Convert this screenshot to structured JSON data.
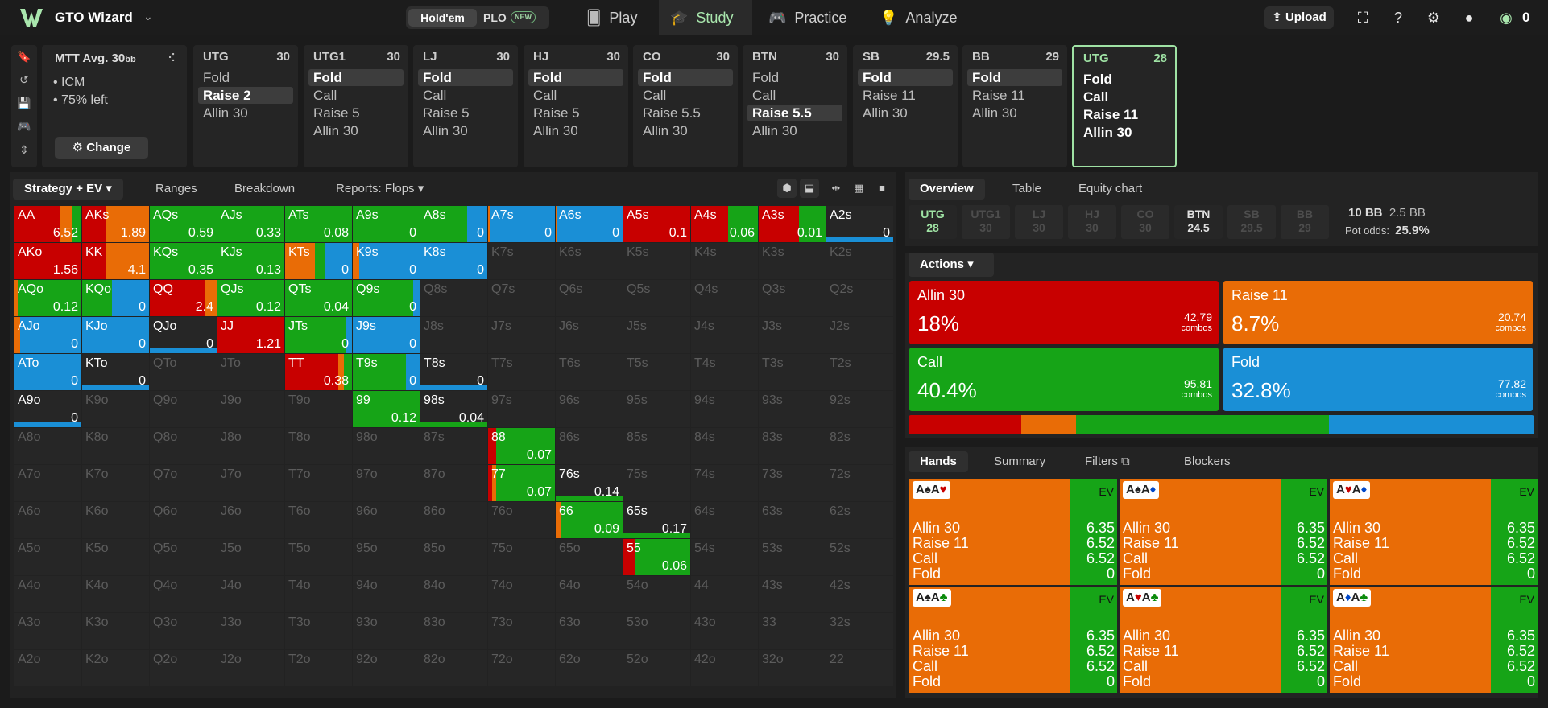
{
  "app": {
    "name": "GTO Wizard"
  },
  "topbar": {
    "variant": {
      "holdem": "Hold'em",
      "plo": "PLO",
      "new_badge": "NEW"
    },
    "nav": [
      "Play",
      "Study",
      "Practice",
      "Analyze"
    ],
    "active_nav": "Study",
    "upload": "Upload",
    "coins": "0"
  },
  "spot": {
    "title": "MTT  Avg. 30",
    "title_suffix": "bb",
    "bullets": [
      "• ICM",
      "• 75% left"
    ],
    "change_label": "Change"
  },
  "action_cards": [
    {
      "pos": "UTG",
      "stack": "30",
      "actions": [
        "Fold",
        "Raise 2",
        "Allin 30"
      ],
      "selected": 1
    },
    {
      "pos": "UTG1",
      "stack": "30",
      "actions": [
        "Fold",
        "Call",
        "Raise 5",
        "Allin 30"
      ],
      "selected": 0
    },
    {
      "pos": "LJ",
      "stack": "30",
      "actions": [
        "Fold",
        "Call",
        "Raise 5",
        "Allin 30"
      ],
      "selected": 0
    },
    {
      "pos": "HJ",
      "stack": "30",
      "actions": [
        "Fold",
        "Call",
        "Raise 5",
        "Allin 30"
      ],
      "selected": 0
    },
    {
      "pos": "CO",
      "stack": "30",
      "actions": [
        "Fold",
        "Call",
        "Raise 5.5",
        "Allin 30"
      ],
      "selected": 0
    },
    {
      "pos": "BTN",
      "stack": "30",
      "actions": [
        "Fold",
        "Call",
        "Raise 5.5",
        "Allin 30"
      ],
      "selected": 2
    },
    {
      "pos": "SB",
      "stack": "29.5",
      "actions": [
        "Fold",
        "Raise 11",
        "Allin 30"
      ],
      "selected": 0
    },
    {
      "pos": "BB",
      "stack": "29",
      "actions": [
        "Fold",
        "Raise 11",
        "Allin 30"
      ],
      "selected": 0
    },
    {
      "pos": "UTG",
      "stack": "28",
      "actions": [
        "Fold",
        "Call",
        "Raise 11",
        "Allin 30"
      ],
      "selected": -1,
      "current": true
    }
  ],
  "matrix_tabs": {
    "strategy": "Strategy + EV",
    "ranges": "Ranges",
    "breakdown": "Breakdown",
    "reports": "Reports: Flops"
  },
  "colors": {
    "allin": "#c80000",
    "raise": "#e96c06",
    "call": "#16a417",
    "fold": "#1a8fd6",
    "empty": "#262626"
  },
  "matrix": [
    [
      "AA|r:.68,o:.17,g:.15|6.52",
      "AKs|r:.35,o:.65|1.89",
      "AQs|g:1|0.59",
      "AJs|g:1|0.33",
      "ATs|g:1|0.08",
      "A9s|g:1|0",
      "A8s|g:.7,b:.3|0",
      "A7s|o:.03,b:.97|0",
      "A6s|o:.03,b:.97|0",
      "A5s|r:1|0.1",
      "A4s|r:.55,g:.45|0.06",
      "A3s|r:.6,g:.4|0.01",
      "A2s|b:p|0"
    ],
    [
      "AKo|r:1|1.56",
      "KK|r:.35,o:.65|4.1",
      "KQs|g:1|0.35",
      "KJs|g:1|0.13",
      "KTs|o:.45,g:.15,b:.4|0",
      "K9s|o:.1,b:.9|0",
      "K8s|b:1|0",
      "K7s",
      "K6s",
      "K5s",
      "K4s",
      "K3s",
      "K2s"
    ],
    [
      "AQo|o:.05,g:.95|0.12",
      "KQo|g:.45,b:.55|0",
      "QQ|r:.82,o:.18|2.4",
      "QJs|g:1|0.12",
      "QTs|g:1|0.04",
      "Q9s|g:.9,b:.1|0",
      "Q8s",
      "Q7s",
      "Q6s",
      "Q5s",
      "Q4s",
      "Q3s",
      "Q2s"
    ],
    [
      "AJo|o:.08,b:.92|0",
      "KJo|b:1|0",
      "QJo|b:p|0",
      "JJ|r:1|1.21",
      "JTs|g:.9,b:.1|0",
      "J9s|b:1|0",
      "J8s",
      "J7s",
      "J6s",
      "J5s",
      "J4s",
      "J3s",
      "J2s"
    ],
    [
      "ATo|b:1|0",
      "KTo|b:p|0",
      "QTo",
      "JTo",
      "TT|r:.8,o:.08,g:.12|0.38",
      "T9s|g:.8,b:.2|0",
      "T8s|b:p|0",
      "T7s",
      "T6s",
      "T5s",
      "T4s",
      "T3s",
      "T2s"
    ],
    [
      "A9o|b:p|0",
      "K9o",
      "Q9o",
      "J9o",
      "T9o",
      "99|g:1|0.12",
      "98s|g:p|0.04",
      "97s",
      "96s",
      "95s",
      "94s",
      "93s",
      "92s"
    ],
    [
      "A8o",
      "K8o",
      "Q8o",
      "J8o",
      "T8o",
      "98o",
      "87s",
      "88|r:.12,g:.88|0.07",
      "86s",
      "85s",
      "84s",
      "83s",
      "82s"
    ],
    [
      "A7o",
      "K7o",
      "Q7o",
      "J7o",
      "T7o",
      "97o",
      "87o",
      "77|r:.06,o:.06,g:.88|0.07",
      "76s|g:p|0.14",
      "75s",
      "74s",
      "73s",
      "72s"
    ],
    [
      "A6o",
      "K6o",
      "Q6o",
      "J6o",
      "T6o",
      "96o",
      "86o",
      "76o",
      "66|o:.08,g:.92|0.09",
      "65s|g:p|0.17",
      "64s",
      "63s",
      "62s"
    ],
    [
      "A5o",
      "K5o",
      "Q5o",
      "J5o",
      "T5o",
      "95o",
      "85o",
      "75o",
      "65o",
      "55|r:.18,g:.82|0.06",
      "54s",
      "53s",
      "52s"
    ],
    [
      "A4o",
      "K4o",
      "Q4o",
      "J4o",
      "T4o",
      "94o",
      "84o",
      "74o",
      "64o",
      "54o",
      "44",
      "43s",
      "42s"
    ],
    [
      "A3o",
      "K3o",
      "Q3o",
      "J3o",
      "T3o",
      "93o",
      "83o",
      "73o",
      "63o",
      "53o",
      "43o",
      "33",
      "32s"
    ],
    [
      "A2o",
      "K2o",
      "Q2o",
      "J2o",
      "T2o",
      "92o",
      "82o",
      "72o",
      "62o",
      "52o",
      "42o",
      "32o",
      "22"
    ]
  ],
  "right_tabs": {
    "overview": "Overview",
    "table": "Table",
    "equity": "Equity chart"
  },
  "positions": [
    {
      "name": "UTG",
      "stack": "28",
      "state": "hero"
    },
    {
      "name": "UTG1",
      "stack": "30",
      "state": "folded"
    },
    {
      "name": "LJ",
      "stack": "30",
      "state": "folded"
    },
    {
      "name": "HJ",
      "stack": "30",
      "state": "folded"
    },
    {
      "name": "CO",
      "stack": "30",
      "state": "folded"
    },
    {
      "name": "BTN",
      "stack": "24.5",
      "state": "active"
    },
    {
      "name": "SB",
      "stack": "29.5",
      "state": "folded"
    },
    {
      "name": "BB",
      "stack": "29",
      "state": "folded"
    }
  ],
  "pot": {
    "bb": "10 BB",
    "bet": "2.5 BB",
    "odds_label": "Pot odds:",
    "odds": "25.9%"
  },
  "actions_label": "Actions",
  "actions": [
    {
      "name": "Allin 30",
      "pct": "18%",
      "combos": "42.79",
      "color": "#c80000"
    },
    {
      "name": "Raise 11",
      "pct": "8.7%",
      "combos": "20.74",
      "color": "#e96c06"
    },
    {
      "name": "Call",
      "pct": "40.4%",
      "combos": "95.81",
      "color": "#16a417"
    },
    {
      "name": "Fold",
      "pct": "32.8%",
      "combos": "77.82",
      "color": "#1a8fd6"
    }
  ],
  "combos_label": "combos",
  "hands_tabs": {
    "hands": "Hands",
    "summary": "Summary",
    "filters": "Filters",
    "blockers": "Blockers"
  },
  "ev_label": "EV",
  "hand_cards": [
    {
      "c1": "A",
      "s1": "♠",
      "c2": "A",
      "s2": "♥",
      "rows": [
        [
          "Allin 30",
          "6.35"
        ],
        [
          "Raise 11",
          "6.52"
        ],
        [
          "Call",
          "6.52"
        ],
        [
          "Fold",
          "0"
        ]
      ]
    },
    {
      "c1": "A",
      "s1": "♠",
      "c2": "A",
      "s2": "♦",
      "rows": [
        [
          "Allin 30",
          "6.35"
        ],
        [
          "Raise 11",
          "6.52"
        ],
        [
          "Call",
          "6.52"
        ],
        [
          "Fold",
          "0"
        ]
      ]
    },
    {
      "c1": "A",
      "s1": "♥",
      "c2": "A",
      "s2": "♦",
      "rows": [
        [
          "Allin 30",
          "6.35"
        ],
        [
          "Raise 11",
          "6.52"
        ],
        [
          "Call",
          "6.52"
        ],
        [
          "Fold",
          "0"
        ]
      ]
    },
    {
      "c1": "A",
      "s1": "♠",
      "c2": "A",
      "s2": "♣",
      "rows": [
        [
          "Allin 30",
          "6.35"
        ],
        [
          "Raise 11",
          "6.52"
        ],
        [
          "Call",
          "6.52"
        ],
        [
          "Fold",
          "0"
        ]
      ]
    },
    {
      "c1": "A",
      "s1": "♥",
      "c2": "A",
      "s2": "♣",
      "rows": [
        [
          "Allin 30",
          "6.35"
        ],
        [
          "Raise 11",
          "6.52"
        ],
        [
          "Call",
          "6.52"
        ],
        [
          "Fold",
          "0"
        ]
      ]
    },
    {
      "c1": "A",
      "s1": "♦",
      "c2": "A",
      "s2": "♣",
      "rows": [
        [
          "Allin 30",
          "6.35"
        ],
        [
          "Raise 11",
          "6.52"
        ],
        [
          "Call",
          "6.52"
        ],
        [
          "Fold",
          "0"
        ]
      ]
    }
  ]
}
